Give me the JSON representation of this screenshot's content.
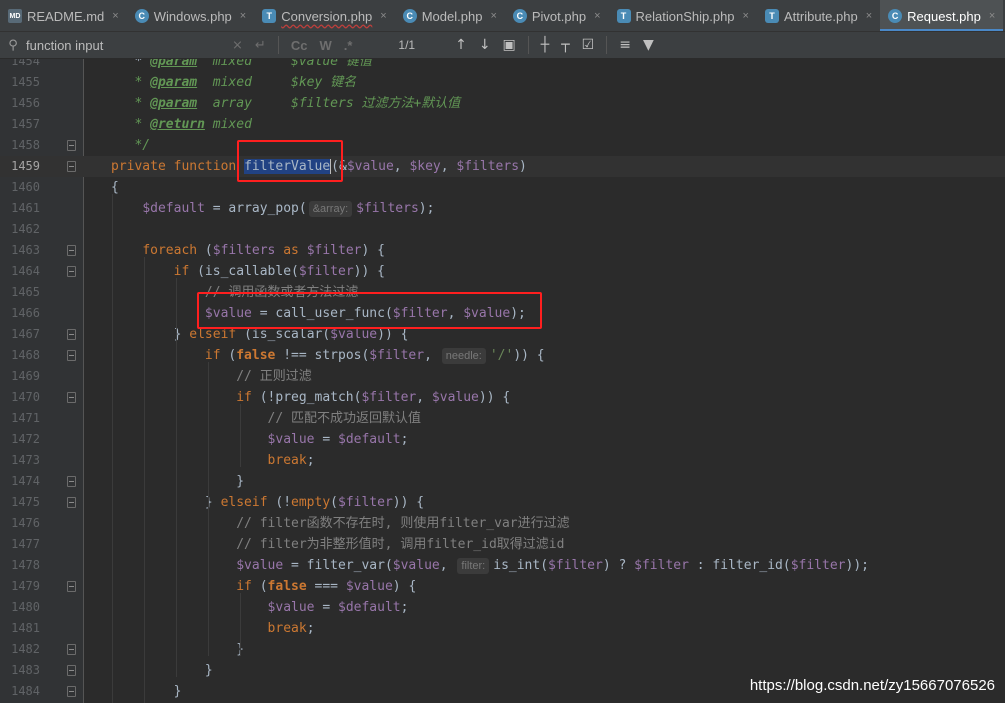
{
  "tabs": [
    {
      "label": "README.md",
      "type": "md",
      "active": false,
      "warn": false
    },
    {
      "label": "Windows.php",
      "type": "php",
      "active": false,
      "warn": false
    },
    {
      "label": "Conversion.php",
      "type": "phpcls",
      "active": false,
      "warn": true
    },
    {
      "label": "Model.php",
      "type": "php",
      "active": false,
      "warn": false
    },
    {
      "label": "Pivot.php",
      "type": "php",
      "active": false,
      "warn": false
    },
    {
      "label": "RelationShip.php",
      "type": "phpcls",
      "active": false,
      "warn": false
    },
    {
      "label": "Attribute.php",
      "type": "phpcls",
      "active": false,
      "warn": false
    },
    {
      "label": "Request.php",
      "type": "php",
      "active": true,
      "warn": false
    }
  ],
  "icons": {
    "md": "MD",
    "php": "C",
    "phpcls": "T",
    "close": "×"
  },
  "search": {
    "value": "function input",
    "match_count": "1/1",
    "case_label": "Cc",
    "word_label": "W",
    "regex_label": ".*"
  },
  "lines": [
    {
      "n": "1454",
      "ind": 0,
      "seg": [
        [
          "",
          "   * "
        ],
        [
          "dt",
          "@param"
        ],
        [
          "dc",
          "  mixed     $value 键值"
        ]
      ]
    },
    {
      "n": "1455",
      "ind": 0,
      "seg": [
        [
          "dc",
          "   * "
        ],
        [
          "dt",
          "@param"
        ],
        [
          "dc",
          "  mixed     "
        ],
        [
          "dc",
          "$key 键名"
        ]
      ]
    },
    {
      "n": "1456",
      "ind": 0,
      "seg": [
        [
          "dc",
          "   * "
        ],
        [
          "dt",
          "@param"
        ],
        [
          "dc",
          "  array     "
        ],
        [
          "dc",
          "$filters 过滤方法+默认值"
        ]
      ]
    },
    {
      "n": "1457",
      "ind": 0,
      "seg": [
        [
          "dc",
          "   * "
        ],
        [
          "dt",
          "@return"
        ],
        [
          "dc",
          " mixed"
        ]
      ]
    },
    {
      "n": "1458",
      "ind": 0,
      "fold": true,
      "seg": [
        [
          "dc",
          "   */"
        ]
      ]
    },
    {
      "n": "1459",
      "ind": 0,
      "fold": true,
      "current": true,
      "seg": [
        [
          "k",
          "private function "
        ],
        [
          "sel",
          "filterValue"
        ],
        [
          "caret",
          ""
        ],
        [
          "",
          "(&"
        ],
        [
          "v",
          "$value"
        ],
        [
          "",
          ", "
        ],
        [
          "v",
          "$key"
        ],
        [
          "",
          ", "
        ],
        [
          "v",
          "$filters"
        ],
        [
          "",
          ")"
        ]
      ]
    },
    {
      "n": "1460",
      "ind": 0,
      "seg": [
        [
          "",
          "{"
        ]
      ]
    },
    {
      "n": "1461",
      "ind": 0,
      "seg": [
        [
          "",
          "    "
        ],
        [
          "v",
          "$default"
        ],
        [
          "",
          " = array_pop("
        ],
        [
          "hint",
          "&array:"
        ],
        [
          "v",
          "$filters"
        ],
        [
          "",
          ");"
        ]
      ]
    },
    {
      "n": "1462",
      "ind": 0,
      "seg": [
        [
          "",
          ""
        ]
      ]
    },
    {
      "n": "1463",
      "ind": 0,
      "fold": true,
      "seg": [
        [
          "",
          "    "
        ],
        [
          "k",
          "foreach"
        ],
        [
          "",
          " ("
        ],
        [
          "v",
          "$filters"
        ],
        [
          "k",
          " as "
        ],
        [
          "v",
          "$filter"
        ],
        [
          "",
          ") {"
        ]
      ]
    },
    {
      "n": "1464",
      "ind": 0,
      "fold": true,
      "seg": [
        [
          "",
          "        "
        ],
        [
          "k",
          "if"
        ],
        [
          "",
          " (is_callable("
        ],
        [
          "v",
          "$filter"
        ],
        [
          "",
          ")) {"
        ]
      ]
    },
    {
      "n": "1465",
      "ind": 0,
      "seg": [
        [
          "",
          "            "
        ],
        [
          "c",
          "// 调用函数或者方法过滤"
        ]
      ]
    },
    {
      "n": "1466",
      "ind": 0,
      "seg": [
        [
          "",
          "            "
        ],
        [
          "v",
          "$value"
        ],
        [
          "",
          " = call_user_func("
        ],
        [
          "v",
          "$filter"
        ],
        [
          "",
          ", "
        ],
        [
          "v",
          "$value"
        ],
        [
          "",
          ");"
        ]
      ]
    },
    {
      "n": "1467",
      "ind": 0,
      "fold": true,
      "seg": [
        [
          "",
          "        } "
        ],
        [
          "k",
          "elseif"
        ],
        [
          "",
          " (is_scalar("
        ],
        [
          "v",
          "$value"
        ],
        [
          "",
          ")) {"
        ]
      ]
    },
    {
      "n": "1468",
      "ind": 0,
      "fold": true,
      "seg": [
        [
          "",
          "            "
        ],
        [
          "k",
          "if"
        ],
        [
          "",
          " ("
        ],
        [
          "cn",
          "false"
        ],
        [
          "",
          " !== strpos("
        ],
        [
          "v",
          "$filter"
        ],
        [
          "",
          ", "
        ],
        [
          "hint",
          "needle:"
        ],
        [
          "s",
          "'/'"
        ],
        [
          "",
          ")) {"
        ]
      ]
    },
    {
      "n": "1469",
      "ind": 0,
      "seg": [
        [
          "",
          "                "
        ],
        [
          "c",
          "// 正则过滤"
        ]
      ]
    },
    {
      "n": "1470",
      "ind": 0,
      "fold": true,
      "seg": [
        [
          "",
          "                "
        ],
        [
          "k",
          "if"
        ],
        [
          "",
          " (!preg_match("
        ],
        [
          "v",
          "$filter"
        ],
        [
          "",
          ", "
        ],
        [
          "v",
          "$value"
        ],
        [
          "",
          ")) {"
        ]
      ]
    },
    {
      "n": "1471",
      "ind": 0,
      "seg": [
        [
          "",
          "                    "
        ],
        [
          "c",
          "// 匹配不成功返回默认值"
        ]
      ]
    },
    {
      "n": "1472",
      "ind": 0,
      "seg": [
        [
          "",
          "                    "
        ],
        [
          "v",
          "$value"
        ],
        [
          "",
          " = "
        ],
        [
          "v",
          "$default"
        ],
        [
          "",
          ";"
        ]
      ]
    },
    {
      "n": "1473",
      "ind": 0,
      "seg": [
        [
          "",
          "                    "
        ],
        [
          "k",
          "break"
        ],
        [
          "",
          ";"
        ]
      ]
    },
    {
      "n": "1474",
      "ind": 0,
      "fold": true,
      "seg": [
        [
          "",
          "                }"
        ]
      ]
    },
    {
      "n": "1475",
      "ind": 0,
      "fold": true,
      "seg": [
        [
          "",
          "            } "
        ],
        [
          "k",
          "elseif"
        ],
        [
          "",
          " (!"
        ],
        [
          "k",
          "empty"
        ],
        [
          "",
          "("
        ],
        [
          "v",
          "$filter"
        ],
        [
          "",
          ")) {"
        ]
      ]
    },
    {
      "n": "1476",
      "ind": 0,
      "seg": [
        [
          "",
          "                "
        ],
        [
          "c",
          "// filter函数不存在时, 则使用filter_var进行过滤"
        ]
      ]
    },
    {
      "n": "1477",
      "ind": 0,
      "seg": [
        [
          "",
          "                "
        ],
        [
          "c",
          "// filter为非整形值时, 调用filter_id取得过滤id"
        ]
      ]
    },
    {
      "n": "1478",
      "ind": 0,
      "seg": [
        [
          "",
          "                "
        ],
        [
          "v",
          "$value"
        ],
        [
          "",
          " = filter_var("
        ],
        [
          "v",
          "$value"
        ],
        [
          "",
          ", "
        ],
        [
          "hint",
          "filter:"
        ],
        [
          "",
          "is_int("
        ],
        [
          "v",
          "$filter"
        ],
        [
          "",
          ") ? "
        ],
        [
          "v",
          "$filter"
        ],
        [
          "",
          " : filter_id("
        ],
        [
          "v",
          "$filter"
        ],
        [
          "",
          "));"
        ]
      ]
    },
    {
      "n": "1479",
      "ind": 0,
      "fold": true,
      "seg": [
        [
          "",
          "                "
        ],
        [
          "k",
          "if"
        ],
        [
          "",
          " ("
        ],
        [
          "cn",
          "false"
        ],
        [
          "",
          " === "
        ],
        [
          "v",
          "$value"
        ],
        [
          "",
          ") {"
        ]
      ]
    },
    {
      "n": "1480",
      "ind": 0,
      "seg": [
        [
          "",
          "                    "
        ],
        [
          "v",
          "$value"
        ],
        [
          "",
          " = "
        ],
        [
          "v",
          "$default"
        ],
        [
          "",
          ";"
        ]
      ]
    },
    {
      "n": "1481",
      "ind": 0,
      "seg": [
        [
          "",
          "                    "
        ],
        [
          "k",
          "break"
        ],
        [
          "",
          ";"
        ]
      ]
    },
    {
      "n": "1482",
      "ind": 0,
      "fold": true,
      "seg": [
        [
          "",
          "                }"
        ]
      ]
    },
    {
      "n": "1483",
      "ind": 0,
      "fold": true,
      "seg": [
        [
          "",
          "            }"
        ]
      ]
    },
    {
      "n": "1484",
      "ind": 0,
      "fold": true,
      "seg": [
        [
          "",
          "        }"
        ]
      ]
    }
  ],
  "watermark": "https://blog.csdn.net/zy15667076526"
}
